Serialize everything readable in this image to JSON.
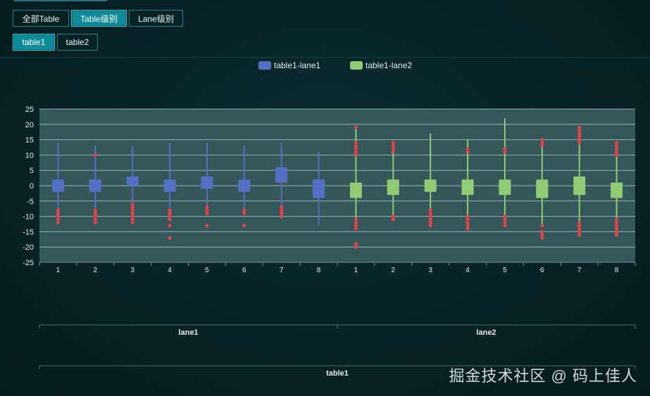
{
  "toolbar": {
    "level_tabs": [
      {
        "label": "全部Table",
        "active": false
      },
      {
        "label": "Table级别",
        "active": true
      },
      {
        "label": "Lane级别",
        "active": false
      }
    ],
    "table_tabs": [
      {
        "label": "table1",
        "active": true
      },
      {
        "label": "table2",
        "active": false
      }
    ]
  },
  "watermark": "掘金技术社区 @ 码上佳人",
  "colors": {
    "lane1": "#5470c6",
    "lane2": "#91cc75",
    "outlier": "#e0434a",
    "plot_bg": "#34575a",
    "grid": "#a9c2c3",
    "text": "#e6eef0"
  },
  "chart_data": {
    "type": "boxplot",
    "legend_position": "top-center",
    "grid": true,
    "ylim": [
      -25,
      25
    ],
    "yticks": [
      25,
      20,
      15,
      10,
      5,
      0,
      -5,
      -10,
      -15,
      -20,
      -25
    ],
    "categories": [
      "1",
      "2",
      "3",
      "4",
      "5",
      "6",
      "7",
      "8",
      "1",
      "2",
      "3",
      "4",
      "5",
      "6",
      "7",
      "8"
    ],
    "group_labels": [
      "lane1",
      "lane2"
    ],
    "outer_label": "table1",
    "series": [
      {
        "name": "table1-lane1",
        "boxes": [
          {
            "x": "1",
            "min": -8,
            "q1": -2,
            "median": 0,
            "q3": 2,
            "max": 14,
            "outliers": [
              -8,
              -9,
              -10,
              -11,
              -12
            ]
          },
          {
            "x": "2",
            "min": -8,
            "q1": -2,
            "median": 0,
            "q3": 2,
            "max": 13,
            "outliers": [
              10,
              -8,
              -9,
              -10,
              -11,
              -12
            ]
          },
          {
            "x": "3",
            "min": -6,
            "q1": 0,
            "median": 1,
            "q3": 3,
            "max": 13,
            "outliers": [
              -6,
              -7,
              -8,
              -9,
              -10,
              -11,
              -12
            ]
          },
          {
            "x": "4",
            "min": -8,
            "q1": -2,
            "median": 0,
            "q3": 2,
            "max": 14,
            "outliers": [
              -8,
              -9,
              -10,
              -11,
              -13,
              -17
            ]
          },
          {
            "x": "5",
            "min": -7,
            "q1": -1,
            "median": 1,
            "q3": 3,
            "max": 14,
            "outliers": [
              -7,
              -8,
              -9,
              -13
            ]
          },
          {
            "x": "6",
            "min": -8,
            "q1": -2,
            "median": 0,
            "q3": 2,
            "max": 13,
            "outliers": [
              -8,
              -9,
              -13
            ]
          },
          {
            "x": "7",
            "min": -7,
            "q1": 1,
            "median": 3,
            "q3": 6,
            "max": 14,
            "outliers": [
              -7,
              -8,
              -9,
              -10
            ]
          },
          {
            "x": "8",
            "min": -13,
            "q1": -4,
            "median": -1,
            "q3": 2,
            "max": 11,
            "outliers": []
          }
        ]
      },
      {
        "name": "table1-lane2",
        "boxes": [
          {
            "x": "1",
            "min": -11,
            "q1": -4,
            "median": -2,
            "q3": 1,
            "max": 19,
            "outliers": [
              19,
              14,
              13,
              12,
              11,
              10,
              -11,
              -12,
              -13,
              -14,
              -19,
              -20
            ]
          },
          {
            "x": "2",
            "min": -10,
            "q1": -3,
            "median": 0,
            "q3": 2,
            "max": 14,
            "outliers": [
              14,
              13,
              12,
              11,
              -10,
              -11
            ]
          },
          {
            "x": "3",
            "min": -8,
            "q1": -2,
            "median": 0,
            "q3": 2,
            "max": 17,
            "outliers": [
              -8,
              -9,
              -10,
              -11,
              -12,
              -13
            ]
          },
          {
            "x": "4",
            "min": -10,
            "q1": -3,
            "median": 0,
            "q3": 2,
            "max": 15,
            "outliers": [
              12,
              11,
              -10,
              -11,
              -12,
              -13,
              -14
            ]
          },
          {
            "x": "5",
            "min": -10,
            "q1": -3,
            "median": 0,
            "q3": 2,
            "max": 22,
            "outliers": [
              12,
              11,
              -10,
              -11,
              -12,
              -13
            ]
          },
          {
            "x": "6",
            "min": -13,
            "q1": -4,
            "median": -1,
            "q3": 2,
            "max": 15,
            "outliers": [
              15,
              14,
              13,
              -13,
              -15,
              -16,
              -17
            ]
          },
          {
            "x": "7",
            "min": -12,
            "q1": -3,
            "median": 0,
            "q3": 3,
            "max": 19,
            "outliers": [
              19,
              18,
              17,
              16,
              15,
              14,
              -12,
              -13,
              -14,
              -15,
              -16
            ]
          },
          {
            "x": "8",
            "min": -11,
            "q1": -4,
            "median": -2,
            "q3": 1,
            "max": 14,
            "outliers": [
              14,
              13,
              12,
              11,
              10,
              -11,
              -12,
              -13,
              -14,
              -15,
              -16
            ]
          }
        ]
      }
    ]
  }
}
